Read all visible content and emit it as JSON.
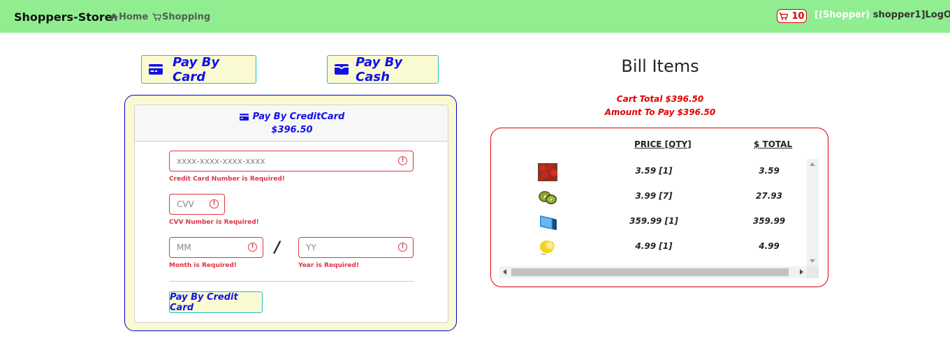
{
  "navbar": {
    "brand": "Shoppers-Store",
    "home_label": "Home",
    "shopping_label": "Shopping",
    "cart_count": "10",
    "user_open": "[",
    "user_role": "(Shopper)",
    "user_name": " shopper1]",
    "logout_label": "LogOut"
  },
  "payment_tabs": {
    "card_label": "Pay By Card",
    "cash_label": "Pay By Cash"
  },
  "card_form": {
    "header_title": "Pay By CreditCard",
    "header_amount": "$396.50",
    "card_number_placeholder": "xxxx-xxxx-xxxx-xxxx",
    "card_number_error": "Credit Card Number is Required!",
    "cvv_placeholder": "CVV",
    "cvv_error": "CVV Number is Required!",
    "month_placeholder": "MM",
    "month_error": "Month is Required!",
    "separator": "/",
    "year_placeholder": "YY",
    "year_error": "Year is Required!",
    "submit_label": "Pay By Credit Card"
  },
  "bill": {
    "title": "Bill Items",
    "cart_total": "Cart Total $396.50",
    "amount_to_pay": "Amount To Pay $396.50",
    "columns": {
      "price": "PRICE [QTY]",
      "total": "$ TOTAL"
    },
    "items": [
      {
        "image": "tomatoes-image",
        "price": "3.59 [1]",
        "total": "3.59"
      },
      {
        "image": "kiwi-image",
        "price": "3.99 [7]",
        "total": "27.93"
      },
      {
        "image": "tablet-image",
        "price": "359.99 [1]",
        "total": "359.99"
      },
      {
        "image": "lemon-image",
        "price": "4.99 [1]",
        "total": "4.99"
      }
    ]
  },
  "colors": {
    "navbar_bg": "#90ee90",
    "button_bg": "#fafad2",
    "accent_blue": "#1010ee",
    "error_red": "#dc3545",
    "bill_red": "#e00000"
  }
}
